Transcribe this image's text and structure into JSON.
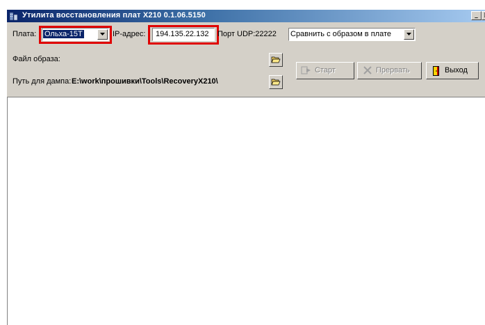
{
  "window": {
    "title": "Утилита восстановления плат X210 0.1.06.5150",
    "caption_buttons": {
      "minimize": "_",
      "maximize": "□",
      "close": "×"
    }
  },
  "toolbar": {
    "board_label": "Плата:",
    "board_value": "Ольха-15Т",
    "ip_label": "IP-адрес:",
    "ip_value": "194.135.22.132",
    "port_label": "Порт UDP:22222",
    "mode_value": "Сравнить с образом в плате",
    "image_file_label": "Файл образа:",
    "image_file_value": "",
    "dump_path_label": "Путь для дампа:",
    "dump_path_value": "E:\\work\\прошивки\\Tools\\RecoveryX210\\",
    "start_label": "Старт",
    "abort_label": "Прервать",
    "exit_label": "Выход"
  },
  "icons": {
    "app": "app-icon",
    "open_folder": "open-folder-icon",
    "start": "start-icon",
    "abort": "abort-icon",
    "exit": "exit-door-icon"
  },
  "colors": {
    "highlight": "#e00000",
    "title_start": "#0a246a",
    "title_end": "#a6caf0",
    "face": "#d4d0c8"
  }
}
